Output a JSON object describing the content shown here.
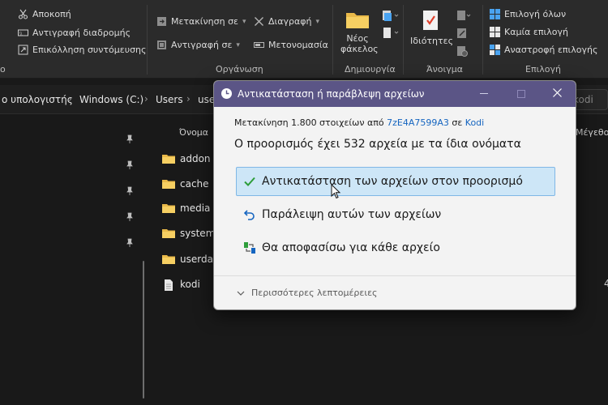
{
  "ribbon": {
    "clipboard": {
      "cut": "Αποκοπή",
      "copy_path": "Αντιγραφή διαδρομής",
      "paste_shortcut": "Επικόλληση συντόμευσης",
      "group_partial": "ο"
    },
    "organize": {
      "move_to": "Μετακίνηση σε",
      "copy_to": "Αντιγραφή σε",
      "delete": "Διαγραφή",
      "rename": "Μετονομασία",
      "group": "Οργάνωση"
    },
    "new": {
      "new_folder": "Νέος φάκελος",
      "new_folder_line1": "Νέος",
      "new_folder_line2": "φάκελος",
      "group": "Δημιουργία"
    },
    "open": {
      "properties": "Ιδιότητες",
      "group": "Άνοιγμα"
    },
    "select": {
      "select_all": "Επιλογή όλων",
      "select_none": "Καμία επιλογή",
      "invert": "Αναστροφή επιλογής",
      "group": "Επιλογή"
    },
    "accent": "#4aa3f0"
  },
  "address": {
    "crumbs": [
      "ο υπολογιστής",
      "Windows (C:)",
      "Users",
      "use"
    ],
    "search_partial": "kodi"
  },
  "files": {
    "col_name": "Όνομα",
    "col_size": "Μέγεθο",
    "items": [
      {
        "name": "addon",
        "type": "folder"
      },
      {
        "name": "cache",
        "type": "folder"
      },
      {
        "name": "media",
        "type": "folder"
      },
      {
        "name": "system",
        "type": "folder"
      },
      {
        "name": "userda",
        "type": "folder"
      },
      {
        "name": "kodi",
        "type": "file"
      }
    ],
    "kodi_size_partial": "4"
  },
  "dialog": {
    "title": "Αντικατάσταση ή παράβλεψη αρχείων",
    "info_prefix": "Μετακίνηση 1.800 στοιχείων από",
    "source": "7zE4A7599A3",
    "info_mid": "σε",
    "destination": "Kodi",
    "heading": "Ο προορισμός έχει 532 αρχεία με τα ίδια ονόματα",
    "options": [
      {
        "label": "Αντικατάσταση των αρχείων στον προορισμό",
        "icon": "check-icon",
        "selected": true
      },
      {
        "label": "Παράλειψη αυτών των αρχείων",
        "icon": "undo-arrow-icon",
        "selected": false
      },
      {
        "label": "Θα αποφασίσω για κάθε αρχείο",
        "icon": "compare-files-icon",
        "selected": false
      }
    ],
    "more_details": "Περισσότερες λεπτομέρειες",
    "title_color": "#5b5586",
    "selected_color": "#cde6f7"
  }
}
